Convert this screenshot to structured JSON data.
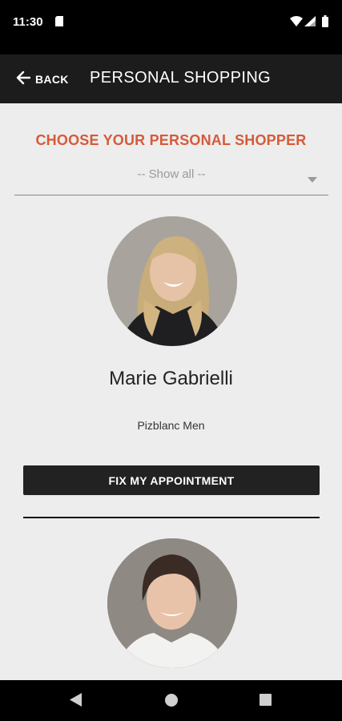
{
  "status_bar": {
    "time": "11:30"
  },
  "app_bar": {
    "back_label": "BACK",
    "title": "PERSONAL SHOPPING"
  },
  "main": {
    "heading": "CHOOSE YOUR PERSONAL SHOPPER",
    "filter": {
      "selected": "-- Show all --"
    },
    "shoppers": [
      {
        "name": "Marie Gabrielli",
        "store": "Pizblanc Men",
        "button_label": "FIX MY APPOINTMENT"
      }
    ]
  },
  "colors": {
    "accent": "#d65a3a",
    "app_bar": "#1c1c1c",
    "button": "#222222",
    "background": "#ededed"
  },
  "icons": [
    "sim-card-icon",
    "wifi-icon",
    "signal-icon",
    "battery-icon",
    "arrow-left-icon",
    "dropdown-caret-icon",
    "nav-back-icon",
    "nav-home-icon",
    "nav-recents-icon"
  ]
}
